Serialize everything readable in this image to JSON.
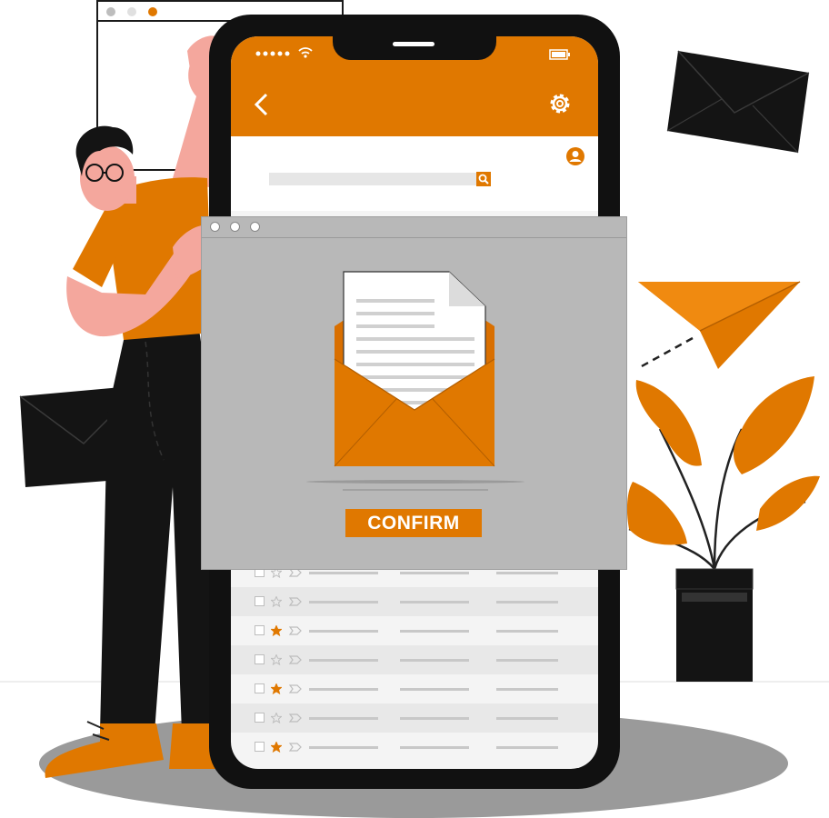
{
  "colors": {
    "accent": "#e07800",
    "dark": "#111111",
    "modal": "#b8b8b8",
    "skin": "#f4a79d"
  },
  "app_bar": {
    "back_icon": "chevron-left-icon",
    "settings_icon": "gear-icon",
    "signal_icon": "signal-dots-icon",
    "wifi_icon": "wifi-icon",
    "battery_icon": "battery-icon"
  },
  "search": {
    "placeholder": "",
    "search_icon": "search-icon",
    "avatar_icon": "user-avatar-icon"
  },
  "email_list": {
    "rows": [
      {
        "starred": false
      },
      {
        "starred": false
      },
      {
        "starred": true
      },
      {
        "starred": false
      },
      {
        "starred": true
      },
      {
        "starred": false
      },
      {
        "starred": true
      }
    ]
  },
  "modal": {
    "window_dots": [
      "close",
      "minimize",
      "maximize"
    ],
    "envelope_icon": "open-envelope-letter-icon",
    "confirm_label": "CONFIRM"
  },
  "decor": {
    "browser_window_dots": [
      "#bdbdbd",
      "#e0e0e0",
      "#e07800"
    ],
    "envelope_top_right": "envelope-icon",
    "envelope_left": "envelope-icon",
    "paper_plane": "paper-plane-icon",
    "plant": "potted-plant-illustration",
    "person": "man-with-glasses-illustration"
  }
}
